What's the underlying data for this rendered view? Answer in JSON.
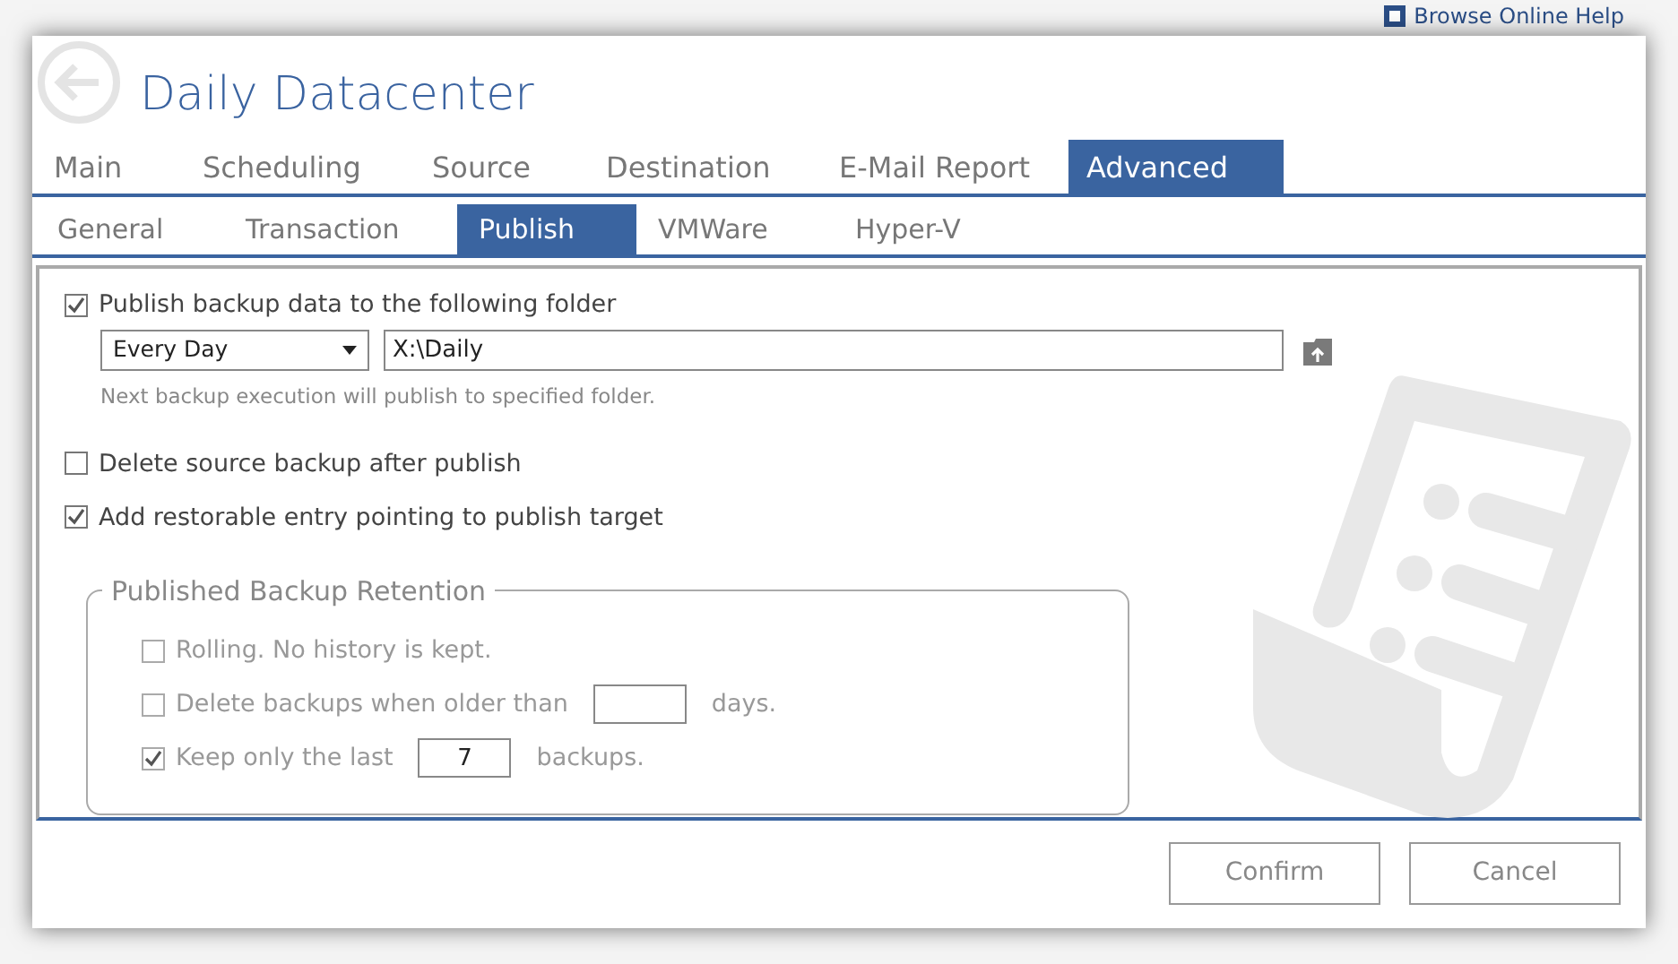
{
  "background": {
    "help_link": "Browse Online Help"
  },
  "dialog": {
    "title": "Daily Datacenter"
  },
  "tabs": [
    {
      "label": "Main",
      "selected": false
    },
    {
      "label": "Scheduling",
      "selected": false
    },
    {
      "label": "Source",
      "selected": false
    },
    {
      "label": "Destination",
      "selected": false
    },
    {
      "label": "E-Mail Report",
      "selected": false
    },
    {
      "label": "Advanced",
      "selected": true
    }
  ],
  "subtabs": [
    {
      "label": "General",
      "selected": false
    },
    {
      "label": "Transaction",
      "selected": false
    },
    {
      "label": "Publish",
      "selected": true
    },
    {
      "label": "VMWare",
      "selected": false
    },
    {
      "label": "Hyper-V",
      "selected": false
    }
  ],
  "publish": {
    "label": "Publish backup data to the following folder",
    "checked": true
  },
  "schedule": {
    "value": "Every Day"
  },
  "folder": {
    "value": "X:\\Daily"
  },
  "hint": "Next backup execution will publish to specified folder.",
  "options": [
    {
      "label": "Delete source backup after publish",
      "checked": false
    },
    {
      "label": "Add restorable entry pointing to publish target",
      "checked": true
    }
  ],
  "retention": {
    "legend": "Published Backup Retention",
    "disabled": true,
    "items": [
      {
        "kind": "plain",
        "label": "Rolling. No history is kept.",
        "checked": false
      },
      {
        "kind": "input",
        "label": "Delete backups when older than",
        "checked": false,
        "suffix": "days."
      },
      {
        "kind": "input",
        "label": "Keep only the last",
        "checked": true,
        "value": "7",
        "suffix": "backups."
      }
    ]
  },
  "buttons": [
    "Confirm",
    "Cancel"
  ]
}
